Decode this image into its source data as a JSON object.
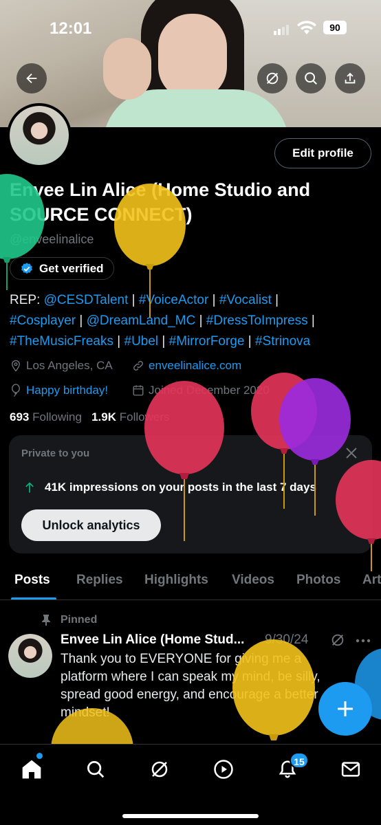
{
  "status_bar": {
    "time": "12:01",
    "battery": "90"
  },
  "profile": {
    "edit_label": "Edit profile",
    "name": "Envee Lin Alice (Home Studio and SOURCE CONNECT)",
    "handle": "@enveelinalice",
    "verify_label": "Get verified",
    "bio": {
      "prefix": "REP: ",
      "tags": [
        "@CESDTalent",
        "#VoiceActor",
        "#Vocalist",
        "#Cosplayer",
        "@DreamLand_MC",
        "#DressToImpress",
        "#TheMusicFreaks",
        "#Ubel",
        "#MirrorForge",
        "#Strinova"
      ],
      "sep": " | "
    },
    "location": "Los Angeles, CA",
    "website": "enveelinalice.com",
    "birthday": "Happy birthday!",
    "joined": "Joined December 2020",
    "following_count": "693",
    "following_label": "Following",
    "followers_count": "1.9K",
    "followers_label": "Followers"
  },
  "analytics_card": {
    "private_label": "Private to you",
    "impressions_text": "41K impressions on your posts in the last 7 days",
    "unlock_label": "Unlock analytics"
  },
  "tabs": [
    "Posts",
    "Replies",
    "Highlights",
    "Videos",
    "Photos",
    "Articles"
  ],
  "active_tab": "Posts",
  "pinned_post": {
    "pinned_label": "Pinned",
    "author": "Envee Lin Alice (Home Stud...",
    "date": "9/30/24",
    "text": "Thank you to EVERYONE for giving me a platform where I can speak my mind, be silly, spread good energy, and encourage a better mindset!"
  },
  "nav": {
    "notifications_badge": "15"
  },
  "colors": {
    "accent": "#1d9bf0",
    "background": "#000000",
    "muted": "#71767b",
    "card": "#16181c",
    "impressions_arrow": "#00ba7c"
  },
  "icons": [
    "back-arrow-icon",
    "grok-icon",
    "search-icon",
    "share-icon",
    "location-icon",
    "link-icon",
    "balloon-icon",
    "calendar-icon",
    "verified-badge-icon",
    "close-icon",
    "arrow-up-icon",
    "pin-icon",
    "more-icon",
    "compose-icon",
    "home-icon",
    "explore-icon",
    "spaces-icon",
    "notifications-icon",
    "messages-icon"
  ]
}
